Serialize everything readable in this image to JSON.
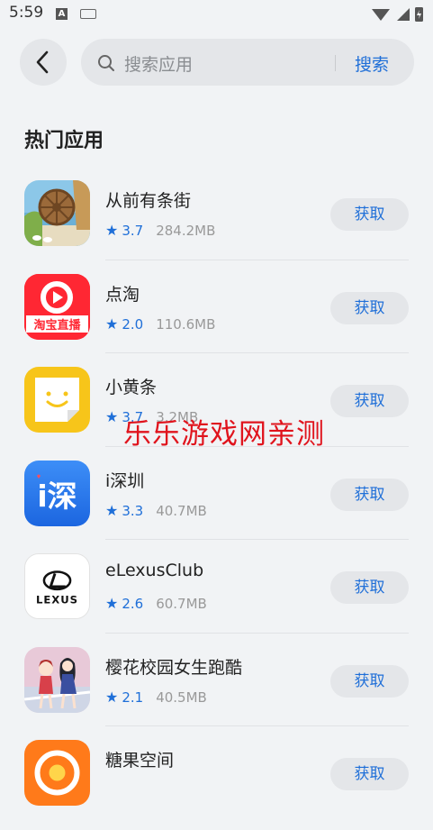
{
  "status_bar": {
    "time": "5:59"
  },
  "search": {
    "placeholder": "搜索应用",
    "button_label": "搜索"
  },
  "section": {
    "title": "热门应用"
  },
  "apps": [
    {
      "name": "从前有条街",
      "rating": "3.7",
      "size": "284.2MB",
      "button": "获取"
    },
    {
      "name": "点淘",
      "rating": "2.0",
      "size": "110.6MB",
      "button": "获取",
      "icon_text": "淘宝直播"
    },
    {
      "name": "小黄条",
      "rating": "3.7",
      "size": "3.2MB",
      "button": "获取"
    },
    {
      "name": "i深圳",
      "rating": "3.3",
      "size": "40.7MB",
      "button": "获取",
      "icon_text": "i深"
    },
    {
      "name": "eLexusClub",
      "rating": "2.6",
      "size": "60.7MB",
      "button": "获取",
      "icon_text": "LEXUS"
    },
    {
      "name": "樱花校园女生跑酷",
      "rating": "2.1",
      "size": "40.5MB",
      "button": "获取"
    },
    {
      "name": "糖果空间",
      "rating": "",
      "size": "",
      "button": "获取"
    }
  ],
  "watermark": "乐乐游戏网亲测",
  "colors": {
    "accent": "#1f6fd8",
    "background": "#f1f3f5",
    "pill": "#e4e6e9"
  }
}
